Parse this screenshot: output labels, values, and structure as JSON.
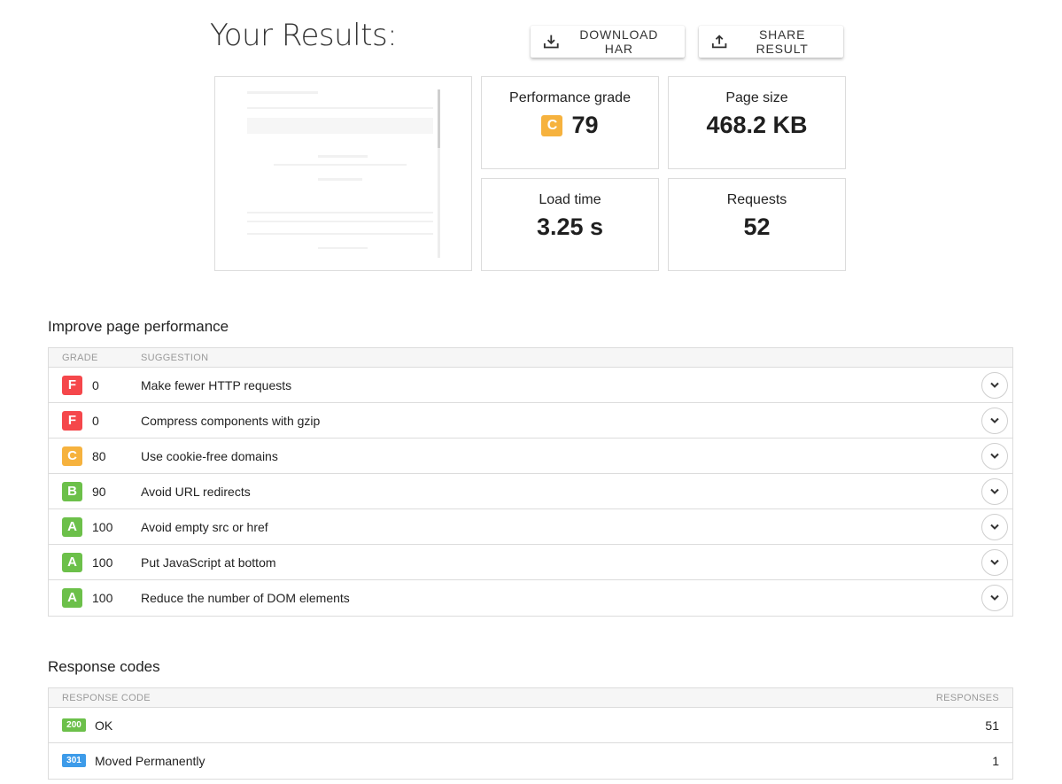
{
  "header": {
    "title": "Your Results:",
    "download_label": "DOWNLOAD HAR",
    "share_label": "SHARE RESULT",
    "download_icon": "download-icon",
    "share_icon": "share-icon"
  },
  "metrics": {
    "performance_grade": {
      "label": "Performance grade",
      "grade": "C",
      "score": "79",
      "grade_color": "#f6b23e"
    },
    "page_size": {
      "label": "Page size",
      "value": "468.2 KB"
    },
    "load_time": {
      "label": "Load time",
      "value": "3.25 s"
    },
    "requests": {
      "label": "Requests",
      "value": "52"
    }
  },
  "improve": {
    "title": "Improve page performance",
    "columns": {
      "grade": "GRADE",
      "suggestion": "SUGGESTION"
    },
    "rows": [
      {
        "grade": "F",
        "score": "0",
        "suggestion": "Make fewer HTTP requests",
        "color": "#f5474b"
      },
      {
        "grade": "F",
        "score": "0",
        "suggestion": "Compress components with gzip",
        "color": "#f5474b"
      },
      {
        "grade": "C",
        "score": "80",
        "suggestion": "Use cookie-free domains",
        "color": "#f6b23e"
      },
      {
        "grade": "B",
        "score": "90",
        "suggestion": "Avoid URL redirects",
        "color": "#6cc04a"
      },
      {
        "grade": "A",
        "score": "100",
        "suggestion": "Avoid empty src or href",
        "color": "#6cc04a"
      },
      {
        "grade": "A",
        "score": "100",
        "suggestion": "Put JavaScript at bottom",
        "color": "#6cc04a"
      },
      {
        "grade": "A",
        "score": "100",
        "suggestion": "Reduce the number of DOM elements",
        "color": "#6cc04a"
      }
    ]
  },
  "response_codes": {
    "title": "Response codes",
    "columns": {
      "code": "RESPONSE CODE",
      "responses": "RESPONSES"
    },
    "rows": [
      {
        "code": "200",
        "text": "OK",
        "count": "51",
        "color": "#6cc04a"
      },
      {
        "code": "301",
        "text": "Moved Permanently",
        "count": "1",
        "color": "#3d9be9"
      }
    ]
  }
}
